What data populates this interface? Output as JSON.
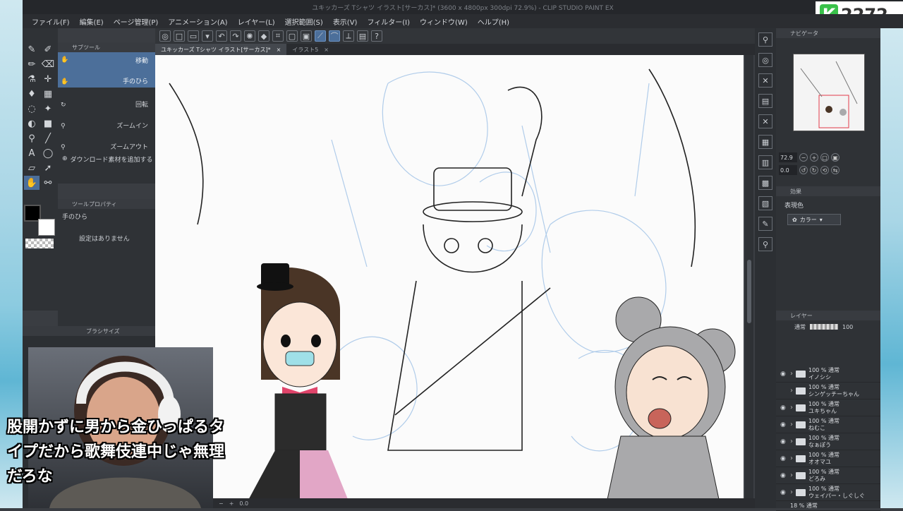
{
  "window": {
    "title": "ユキッカーズ Tシャツ イラスト[サーカス]* (3600 x 4800px 300dpi 72.9%) - CLIP STUDIO PAINT EX"
  },
  "stream_counter": "2272",
  "menu": [
    "ファイル(F)",
    "編集(E)",
    "ページ管理(P)",
    "アニメーション(A)",
    "レイヤー(L)",
    "選択範囲(S)",
    "表示(V)",
    "フィルター(I)",
    "ウィンドウ(W)",
    "ヘルプ(H)"
  ],
  "subtool_panel": {
    "header": "サブツール",
    "items": [
      {
        "label": "移動",
        "selected": true
      },
      {
        "label": "手のひら",
        "selected": true
      },
      {
        "label": "回転",
        "selected": false
      },
      {
        "label": "ズームイン",
        "selected": false
      },
      {
        "label": "ズームアウト",
        "selected": false
      }
    ],
    "download_label": "ダウンロード素材を追加する"
  },
  "tool_property": {
    "header": "ツールプロパティ",
    "tool_name": "手のひら",
    "empty_text": "設定はありません"
  },
  "brush_size_header": "ブラシサイズ",
  "document_tabs": [
    {
      "label": "ユキッカーズ Tシャツ イラスト[サーカス]*",
      "active": true
    },
    {
      "label": "イラスト5",
      "active": false
    }
  ],
  "status": {
    "zoom": "0.0"
  },
  "navigator": {
    "header": "ナビゲータ",
    "zoom": "72.9",
    "rotation": "0.0"
  },
  "effect_panel": {
    "header": "効果",
    "expression_label": "表現色",
    "expression_value": "カラー"
  },
  "layer_panel": {
    "header": "レイヤー",
    "blend_mode": "通常",
    "opacity": "100",
    "layers": [
      {
        "blend": "100 % 通常",
        "name": "イノシシ"
      },
      {
        "blend": "100 % 通常",
        "name": "シンゲッチーちゃん"
      },
      {
        "blend": "100 % 通常",
        "name": "ユキちゃん"
      },
      {
        "blend": "100 % 通常",
        "name": "ねむこ"
      },
      {
        "blend": "100 % 通常",
        "name": "なぁぽう"
      },
      {
        "blend": "100 % 通常",
        "name": "オオマユ"
      },
      {
        "blend": "100 % 通常",
        "name": "どろみ"
      },
      {
        "blend": "100 % 通常",
        "name": "ウェイパー・しぐしぐ"
      },
      {
        "blend": "18 % 通常",
        "name": ""
      }
    ]
  },
  "subtitle": [
    "股開かずに男から金ひっぱるタ",
    "イプだから歌舞伎連中じゃ無理",
    "だろな"
  ],
  "colors": {
    "accent": "#4c6f9a",
    "panel": "#2f3236",
    "counter_green": "#39c14a"
  }
}
